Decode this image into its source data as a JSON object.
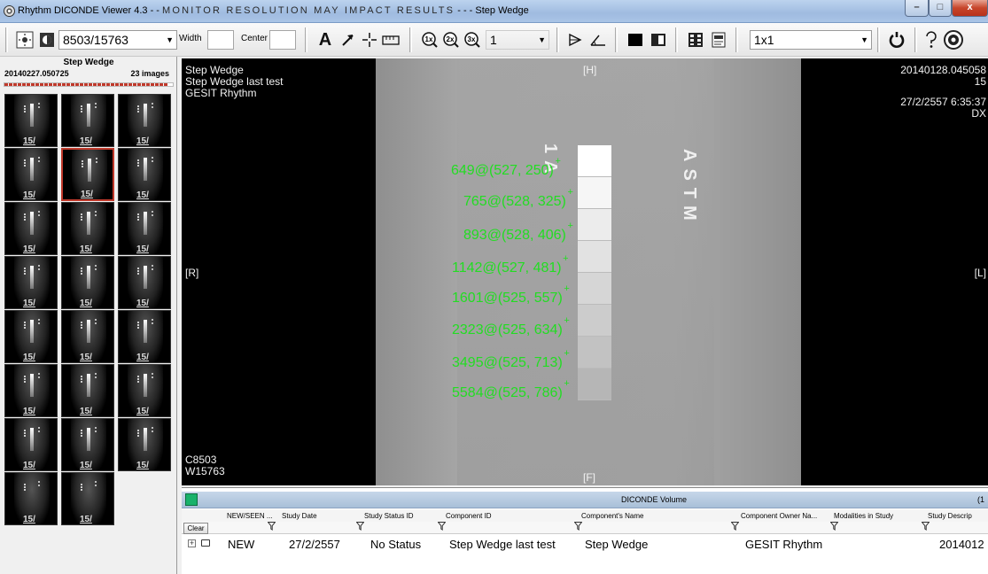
{
  "window": {
    "title_app": "Rhythm DICONDE Viewer 4.3 - - ",
    "title_warning": "MONITOR RESOLUTION MAY IMPACT RESULTS",
    "title_tail": " - - - Step Wedge",
    "minimize": "–",
    "maximize": "□",
    "close": "x"
  },
  "toolbar": {
    "image_selector": "8503/15763",
    "width_label": "Width",
    "center_label": "Center",
    "width_value": "",
    "center_value": "",
    "text_tool": "A",
    "zoom_value": "1",
    "layout_value": "1x1"
  },
  "series_panel": {
    "title": "Step Wedge",
    "date": "20140227.050725",
    "count": "23 images",
    "thumb_label": "15/",
    "load_progress": 0.97
  },
  "viewer": {
    "top_left": [
      "Step Wedge",
      "Step Wedge last test",
      "GESIT Rhythm"
    ],
    "top_right": [
      "20140128.045058",
      "15",
      "",
      "27/2/2557 6:35:37",
      "DX"
    ],
    "orient_top": "[H]",
    "orient_bottom": "[F]",
    "orient_left": "[R]",
    "orient_right": "[L]",
    "bottom_left": [
      "C8503",
      "W15763"
    ],
    "stamp_left": "1A",
    "stamp_right": "ASTM",
    "measurements": [
      "649@(527, 250)",
      "765@(528, 325)",
      "893@(528, 406)",
      "1142@(527, 481)",
      "1601@(525, 557)",
      "2323@(525, 634)",
      "3495@(525, 713)",
      "5584@(525, 786)"
    ],
    "measurement_marker": "+"
  },
  "volume_panel": {
    "title": "DICONDE Volume",
    "count": "(1",
    "columns": [
      "NEW/SEEN ...",
      "Study Date",
      "Study Status ID",
      "Component ID",
      "Component's Name",
      "Component Owner Na...",
      "Modalities in Study",
      "Study Descrip"
    ],
    "clear_label": "Clear",
    "row": {
      "expand": "+",
      "new_seen": "NEW",
      "study_date": "27/2/2557",
      "status": "No Status",
      "component_id": "Step Wedge last test",
      "component_name": "Step Wedge",
      "owner": "GESIT Rhythm",
      "description": "2014012"
    }
  },
  "colors": {
    "measurement": "#22dd22",
    "selected_thumb": "#c0392b",
    "volume_status": "#19b26b"
  }
}
